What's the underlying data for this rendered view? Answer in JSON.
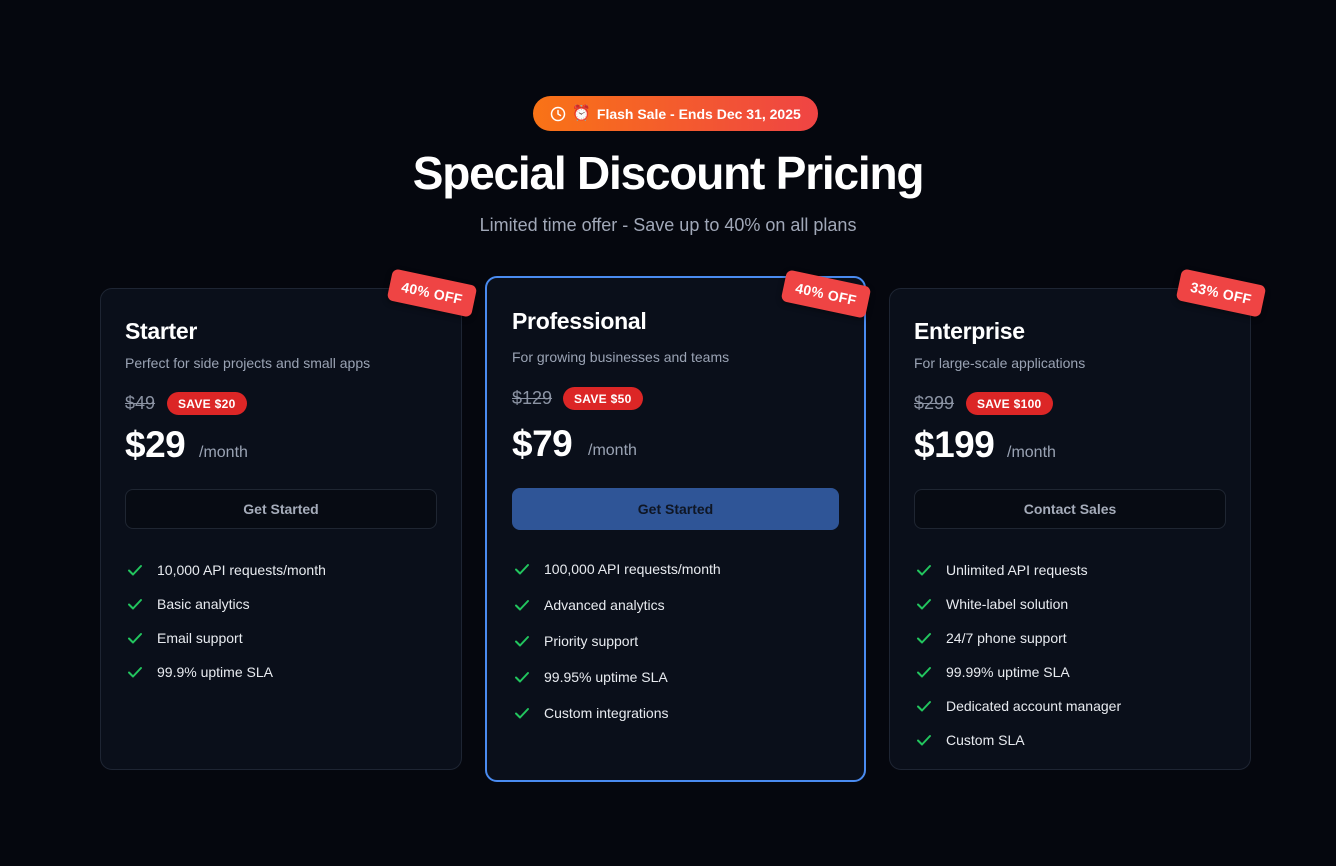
{
  "banner": {
    "icon": "clock-icon",
    "emoji": "⏰",
    "text": "Flash Sale - Ends Dec 31, 2025"
  },
  "header": {
    "title": "Special Discount Pricing",
    "subtitle": "Limited time offer - Save up to 40% on all plans"
  },
  "colors": {
    "accent": "#4a8bf0",
    "discount_red": "#ef4444",
    "check_green": "#22c55e",
    "background": "#05070e"
  },
  "plans": [
    {
      "ribbon": "40% OFF",
      "name": "Starter",
      "description": "Perfect for side projects and small apps",
      "old_price": "$49",
      "save": "SAVE $20",
      "price": "$29",
      "period": "/month",
      "cta": "Get Started",
      "features": [
        "10,000 API requests/month",
        "Basic analytics",
        "Email support",
        "99.9% uptime SLA"
      ]
    },
    {
      "ribbon": "40% OFF",
      "name": "Professional",
      "description": "For growing businesses and teams",
      "old_price": "$129",
      "save": "SAVE $50",
      "price": "$79",
      "period": "/month",
      "cta": "Get Started",
      "features": [
        "100,000 API requests/month",
        "Advanced analytics",
        "Priority support",
        "99.95% uptime SLA",
        "Custom integrations"
      ]
    },
    {
      "ribbon": "33% OFF",
      "name": "Enterprise",
      "description": "For large-scale applications",
      "old_price": "$299",
      "save": "SAVE $100",
      "price": "$199",
      "period": "/month",
      "cta": "Contact Sales",
      "features": [
        "Unlimited API requests",
        "White-label solution",
        "24/7 phone support",
        "99.99% uptime SLA",
        "Dedicated account manager",
        "Custom SLA"
      ]
    }
  ]
}
